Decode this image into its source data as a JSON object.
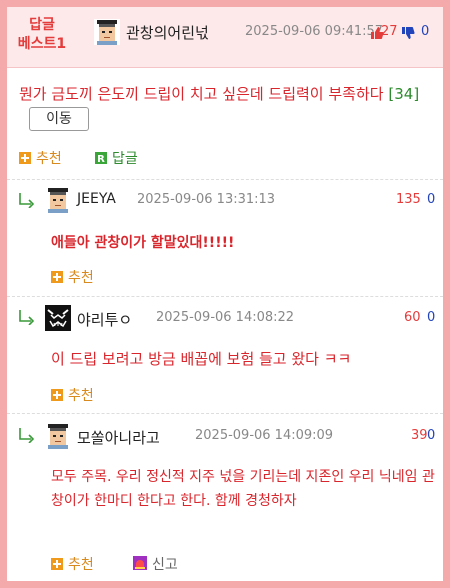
{
  "header": {
    "badge_line1": "답글",
    "badge_line2": "베스트1",
    "nickname": "관창의어린넋",
    "date": "2025-09-06 09:41:57",
    "up_count": "27",
    "down_count": "0"
  },
  "post": {
    "text": "뭔가 금도끼 은도끼 드립이 치고 싶은데 드립력이 부족하다",
    "reply_count": "[34]",
    "move_button": "이동",
    "recommend_label": "추천",
    "reply_label": "답글"
  },
  "comments": [
    {
      "nickname": "JEEYA",
      "date": "2025-09-06 13:31:13",
      "up": "135",
      "down": "0",
      "text": "애들아 관창이가 할말있대!!!!!",
      "recommend_label": "추천"
    },
    {
      "nickname": "야리투ㅇ",
      "date": "2025-09-06 14:08:22",
      "up": "60",
      "down": "0",
      "text": "이 드립 보려고 방금 배꼽에 보험 들고 왔다 ㅋㅋ",
      "recommend_label": "추천"
    },
    {
      "nickname": "모쏠아니라고",
      "date": "2025-09-06 14:09:09",
      "up": "39",
      "down": "0",
      "text": "모두 주목. 우리 정신적 지주 넋을 기리는데 지존인 우리 닉네임 관창이가 한마디 한다고 한다. 함께 경청하자",
      "recommend_label": "추천",
      "report_label": "신고"
    }
  ],
  "icons": {
    "up": "thumbs-up-icon",
    "down": "thumbs-down-icon",
    "recommend": "plus-square-icon",
    "reply": "r-square-icon",
    "reply_arrow": "reply-arrow-icon",
    "report": "siren-icon"
  },
  "colors": {
    "frame": "#f4a9ab",
    "header_bg": "#fde9ea",
    "accent_red": "#d9262c",
    "recommend_orange": "#d98a1e",
    "reply_green": "#2e8b2e",
    "down_blue": "#2244bb"
  }
}
